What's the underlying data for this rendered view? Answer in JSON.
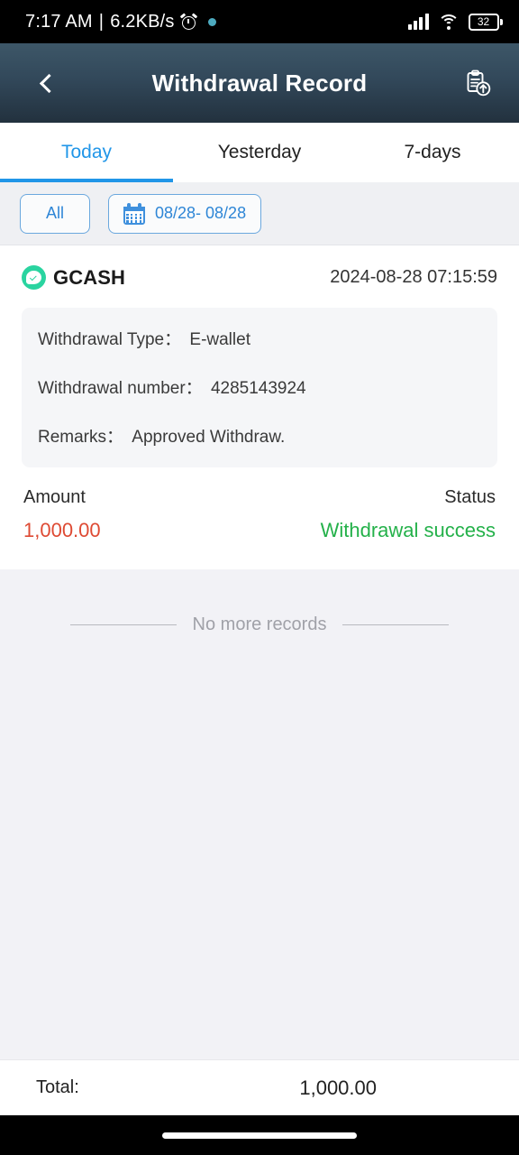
{
  "status_bar": {
    "time": "7:17 AM",
    "separator": "|",
    "network_speed": "6.2KB/s",
    "alarm_icon": "alarm-clock-icon",
    "indicator_dot": "notification-dot-icon",
    "signal_icon": "cellular-signal-icon",
    "wifi_icon": "wifi-icon",
    "battery_level": "32"
  },
  "header": {
    "back_icon": "back-chevron-icon",
    "title": "Withdrawal Record",
    "action_icon": "clipboard-upload-icon"
  },
  "tabs": [
    {
      "label": "Today",
      "active": true
    },
    {
      "label": "Yesterday",
      "active": false
    },
    {
      "label": "7-days",
      "active": false
    }
  ],
  "filters": {
    "all_label": "All",
    "calendar_icon": "calendar-icon",
    "date_range": "08/28- 08/28"
  },
  "record": {
    "brand_logo": "gcash-logo-icon",
    "brand": "GCASH",
    "timestamp": "2024-08-28 07:15:59",
    "details": [
      {
        "label": "Withdrawal Type：",
        "value": "E-wallet"
      },
      {
        "label": "Withdrawal number：",
        "value": "4285143924"
      },
      {
        "label": "Remarks：",
        "value": "Approved Withdraw."
      }
    ],
    "amount_label": "Amount",
    "amount_value": "1,000.00",
    "status_label": "Status",
    "status_value": "Withdrawal success"
  },
  "empty_state": {
    "text": "No more records"
  },
  "footer": {
    "total_label": "Total:",
    "total_value": "1,000.00"
  },
  "colors": {
    "accent_blue": "#2196e8",
    "header_top": "#3d5768",
    "header_bottom": "#22313e",
    "amount_red": "#de4a33",
    "status_green": "#24b14a",
    "gcash_green": "#2ad4a0",
    "page_bg": "#f2f2f6"
  }
}
